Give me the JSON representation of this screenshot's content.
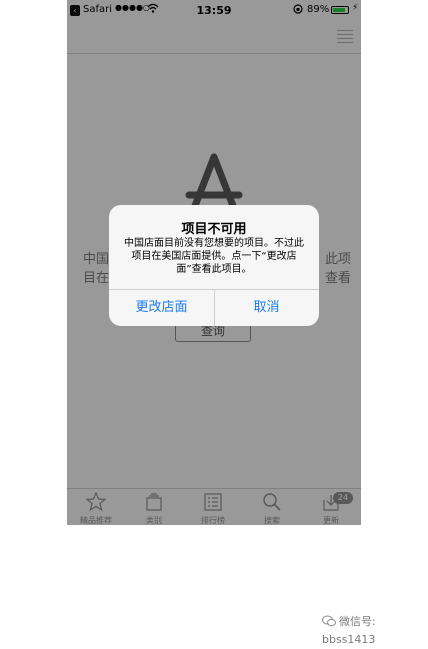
{
  "status_bar": {
    "back_glyph": "‹",
    "carrier": "Safari",
    "signal_dots": "●●●●○",
    "time": "13:59",
    "battery_percent": "89%",
    "battery_level": 0.89
  },
  "content": {
    "message_left_line1": "中国",
    "message_left_line2": "目在",
    "message_right_line1": "此项",
    "message_right_line2": "查看",
    "search_button": "查询"
  },
  "alert": {
    "title": "项目不可用",
    "message": "中国店面目前没有您想要的项目。不过此项目在美国店面提供。点一下“更改店面”查看此项目。",
    "change_store_button": "更改店面",
    "cancel_button": "取消",
    "button_color": "#1a7cf0"
  },
  "tab_bar": {
    "tabs": [
      {
        "label": "精品推荐",
        "icon": "star-icon"
      },
      {
        "label": "类别",
        "icon": "categories-icon"
      },
      {
        "label": "排行榜",
        "icon": "top-charts-icon"
      },
      {
        "label": "搜索",
        "icon": "search-icon"
      },
      {
        "label": "更新",
        "icon": "updates-icon"
      }
    ],
    "updates_badge": "24"
  },
  "watermark": {
    "text": "微信号: bbss1413"
  }
}
